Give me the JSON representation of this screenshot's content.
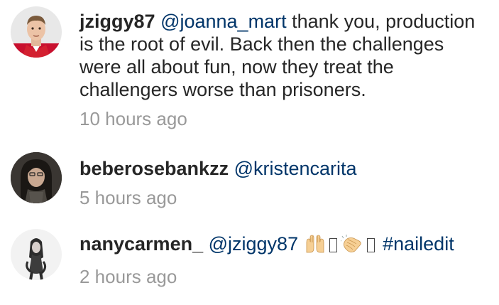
{
  "comments": [
    {
      "username": "jziggy87",
      "mention": "@joanna_mart",
      "text": " thank you, production is the root of evil. Back then the challenges were all about fun, now they treat the challengers worse than prisoners.",
      "time": "10 hours ago",
      "avatar_icon": "avatar-jziggy87"
    },
    {
      "username": "beberosebankzz",
      "mention": "@kristencarita",
      "text": "",
      "time": "5 hours ago",
      "avatar_icon": "avatar-beberosebankzz"
    },
    {
      "username": "nanycarmen_",
      "mention": "@jziggy87",
      "emojis": [
        "raising-hands-emoji",
        "missing-glyph-box",
        "clapping-hands-emoji",
        "missing-glyph-box"
      ],
      "hashtag": "#nailedit",
      "time": "2 hours ago",
      "avatar_icon": "avatar-nanycarmen"
    }
  ],
  "colors": {
    "username": "#262626",
    "link": "#003569",
    "timestamp": "#999999",
    "background": "#ffffff"
  }
}
